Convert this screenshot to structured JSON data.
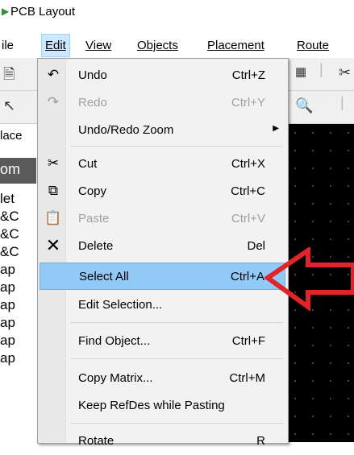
{
  "window": {
    "title": "PCB Layout"
  },
  "menubar": {
    "items": [
      {
        "label": "ile"
      },
      {
        "label": "Edit"
      },
      {
        "label": "View"
      },
      {
        "label": "Objects"
      },
      {
        "label": "Placement"
      },
      {
        "label": "Route"
      }
    ]
  },
  "left_panel": {
    "rows": [
      "lace",
      "om",
      "let",
      "&C",
      "&C",
      "&C",
      "ap",
      "ap",
      "ap",
      "ap",
      "ap",
      "ap"
    ]
  },
  "edit_menu": {
    "items": [
      {
        "label": "Undo",
        "shortcut": "Ctrl+Z",
        "icon": "undo-icon",
        "enabled": true
      },
      {
        "label": "Redo",
        "shortcut": "Ctrl+Y",
        "icon": "redo-icon",
        "enabled": false
      },
      {
        "label": "Undo/Redo Zoom",
        "shortcut": "",
        "icon": "",
        "enabled": true,
        "submenu": true
      },
      {
        "label": "Cut",
        "shortcut": "Ctrl+X",
        "icon": "scissors-icon",
        "enabled": true
      },
      {
        "label": "Copy",
        "shortcut": "Ctrl+C",
        "icon": "copy-icon",
        "enabled": true
      },
      {
        "label": "Paste",
        "shortcut": "Ctrl+V",
        "icon": "paste-icon",
        "enabled": false
      },
      {
        "label": "Delete",
        "shortcut": "Del",
        "icon": "delete-x-icon",
        "enabled": true
      },
      {
        "label": "Select All",
        "shortcut": "Ctrl+A",
        "icon": "",
        "enabled": true,
        "highlighted": true
      },
      {
        "label": "Edit Selection...",
        "shortcut": "",
        "icon": "",
        "enabled": true
      },
      {
        "label": "Find Object...",
        "shortcut": "Ctrl+F",
        "icon": "",
        "enabled": true
      },
      {
        "label": "Copy Matrix...",
        "shortcut": "Ctrl+M",
        "icon": "",
        "enabled": true
      },
      {
        "label": "Keep RefDes while Pasting",
        "shortcut": "",
        "icon": "",
        "enabled": true
      },
      {
        "label": "Rotate",
        "shortcut": "R",
        "icon": "",
        "enabled": true
      }
    ]
  },
  "colors": {
    "highlight": "#91c9f7",
    "annotation_arrow": "#e0242a",
    "canvas": "#000000"
  }
}
